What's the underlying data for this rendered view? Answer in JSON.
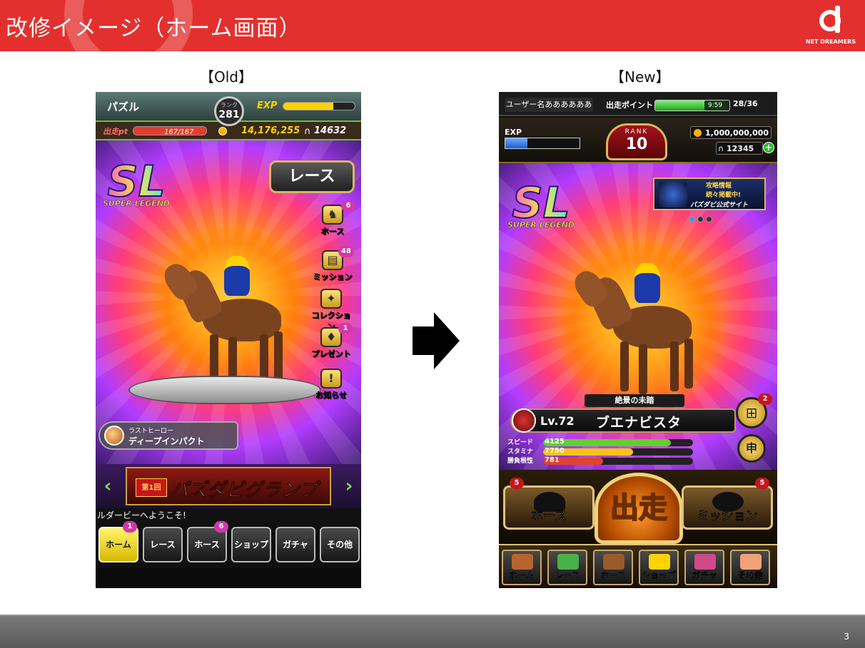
{
  "header": {
    "title": "改修イメージ（ホーム画面）",
    "logo_text": "NET DREAMERS"
  },
  "labels": {
    "old": "【Old】",
    "new": "【New】"
  },
  "old_screen": {
    "name": "パズル",
    "rank_label": "ランク",
    "rank_value": "281",
    "exp_label": "EXP",
    "exp_progress": 0.7,
    "pt_label": "出走pt",
    "pt_value": "167/167",
    "pt_progress": 1.0,
    "coins": "14,176,255",
    "horseshoes": "14632",
    "logo_main": "SL",
    "logo_sub": "SUPER LEGEND",
    "race_button": "レース",
    "side_buttons": [
      {
        "label": "ホース",
        "badge": "6",
        "icon": "horse-icon"
      },
      {
        "label": "ミッション",
        "badge": "48",
        "icon": "mission-icon"
      },
      {
        "label": "コレクション",
        "badge": "",
        "icon": "collection-icon"
      },
      {
        "label": "プレゼント",
        "badge": "1",
        "icon": "present-icon"
      },
      {
        "label": "お知らせ",
        "badge": "",
        "icon": "notice-icon"
      }
    ],
    "last_hero_label": "ラストヒーロー",
    "last_hero_name": "ディープインパクト",
    "banner_number": "第1回",
    "banner_text": "パズダビグランプリ",
    "ticker": "ルダービーへようこそ!",
    "tabs": [
      {
        "label": "ホーム",
        "badge": "1"
      },
      {
        "label": "レース",
        "badge": ""
      },
      {
        "label": "ホース",
        "badge": "6"
      },
      {
        "label": "ショップ",
        "badge": ""
      },
      {
        "label": "ガチャ",
        "badge": ""
      },
      {
        "label": "その他",
        "badge": ""
      }
    ]
  },
  "new_screen": {
    "username": "ユーザー名ああああああ",
    "stamina_label": "出走ポイント",
    "stamina_timer": "9:59",
    "stamina_value": "28/36",
    "stamina_progress": 0.78,
    "exp_label": "EXP",
    "exp_progress": 0.3,
    "rank_label": "RANK",
    "rank_value": "10",
    "coins": "1,000,000,000",
    "horseshoes": "12345",
    "plus": "+",
    "logo_main": "SL",
    "logo_sub": "SUPER LEGEND",
    "promo_line1": "攻略情報",
    "promo_line2": "続々掲載中!",
    "promo_line3": "パズダビ公式サイト",
    "horse_tag": "絶景の未踏",
    "level": "Lv.72",
    "horse_name": "ブエナビスタ",
    "stats": [
      {
        "label": "スピード",
        "value": "4125",
        "ratio": 0.85,
        "color": "#5ed12c"
      },
      {
        "label": "スタミナ",
        "value": "7750",
        "ratio": 0.6,
        "color": "#f2c51c"
      },
      {
        "label": "勝負根性",
        "value": "781",
        "ratio": 0.4,
        "color": "#e0442e"
      }
    ],
    "gift_badge": "2",
    "go_button": "出走",
    "horse_button": "ホース",
    "horse_badge": "5",
    "mission_button": "ミッション",
    "mission_badge": "5",
    "tabs": [
      {
        "label": "ホーム",
        "color": "#b8642e"
      },
      {
        "label": "レース",
        "color": "#4ab04a"
      },
      {
        "label": "ホース",
        "color": "#9a5a2a"
      },
      {
        "label": "ショップ",
        "color": "#ffd200"
      },
      {
        "label": "ガチャ",
        "color": "#d04a8a"
      },
      {
        "label": "その他",
        "color": "#f2a07a"
      }
    ]
  },
  "footer": {
    "page_number": "3"
  }
}
